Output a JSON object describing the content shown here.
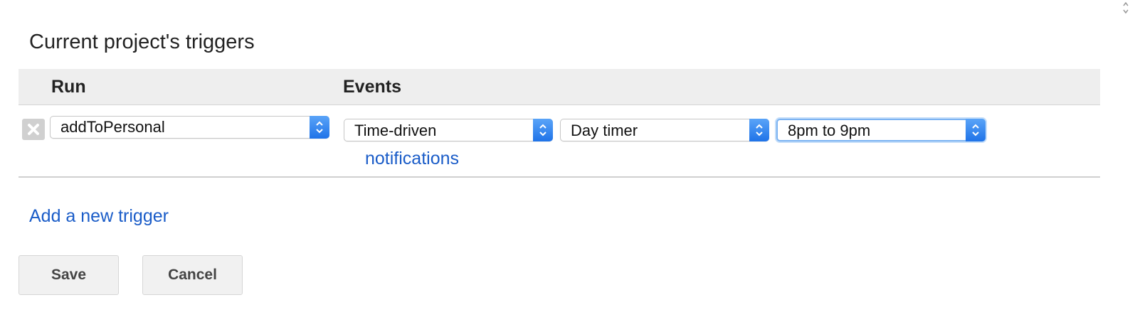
{
  "dialog": {
    "title": "Current project's triggers"
  },
  "table": {
    "headers": {
      "run": "Run",
      "events": "Events"
    },
    "rows": [
      {
        "function": "addToPersonal",
        "event_source": "Time-driven",
        "timer_type": "Day timer",
        "time_window": "8pm to 9pm",
        "notifications_link": "notifications"
      }
    ]
  },
  "add_trigger_link": "Add a new trigger",
  "buttons": {
    "save": "Save",
    "cancel": "Cancel"
  },
  "colors": {
    "link": "#1a5cc8",
    "select_arrow": "#2b7ff0",
    "header_bg": "#eeeeee",
    "focus_ring": "#7bb3f2"
  },
  "icons": {
    "delete": "close-x-icon",
    "select_arrow": "chevron-up-down-icon"
  }
}
